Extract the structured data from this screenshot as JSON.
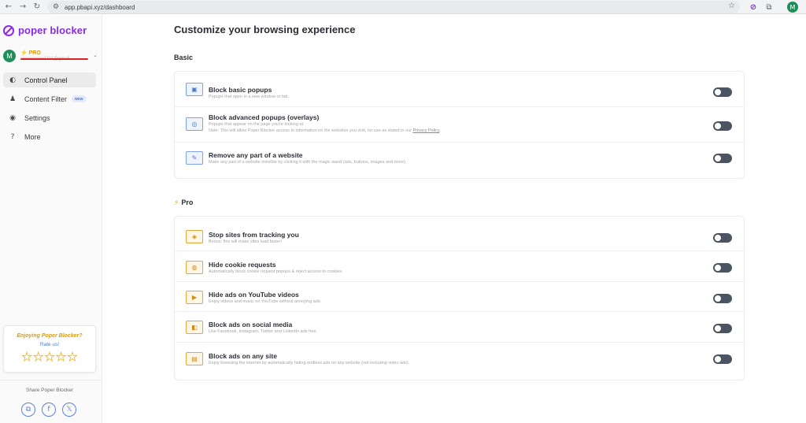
{
  "browser": {
    "back": "←",
    "forward": "→",
    "reload": "↻",
    "site_info": "⚙",
    "url": "app.pbapi.xyz/dashboard",
    "star": "☆",
    "ext_poper": "⊘",
    "ext_puzzle": "⧉",
    "profile_initial": "M"
  },
  "sidebar": {
    "logo_text": "poper blocker",
    "account": {
      "initial": "M",
      "plan": "⚡ PRO",
      "email": "xxxxxxxxxx1111@gmail",
      "chevron": "⌄"
    },
    "menu": [
      {
        "icon": "◐",
        "label": "Control Panel",
        "active": true
      },
      {
        "icon": "♟",
        "label": "Content Filter",
        "badge": "NEW"
      },
      {
        "icon": "◉",
        "label": "Settings"
      },
      {
        "icon": "?",
        "label": "More"
      }
    ],
    "rate_card": {
      "title": "Enjoying Poper Blocker?",
      "link": "Rate us!",
      "stars": [
        "★",
        "★",
        "★",
        "★",
        "★"
      ]
    },
    "share": {
      "label": "Share Poper Blocker",
      "icons": [
        "⧉",
        "f",
        "𝕏"
      ]
    }
  },
  "main": {
    "title": "Customize your browsing experience",
    "basic": {
      "heading": "Basic",
      "rows": [
        {
          "title": "Block basic popups",
          "desc": "Popups that open in a new window or tab.",
          "icon": "▣",
          "on": false
        },
        {
          "title": "Block advanced popups (overlays)",
          "desc": "Popups that appear on the page you're looking at.",
          "desc2_prefix": "Note: This will allow Poper Blocker access to information on the websites you visit, for use as stated in our ",
          "desc2_link": "Privacy Policy",
          "desc2_suffix": ".",
          "icon": "◎",
          "on": false
        },
        {
          "title": "Remove any part of a website",
          "desc": "Make any part of a website invisible by clicking it with the magic wand (ads, buttons, images and more).",
          "icon": "✎",
          "on": false
        }
      ]
    },
    "pro": {
      "bolt": "⚡",
      "heading": "Pro",
      "rows": [
        {
          "title": "Stop sites from tracking you",
          "desc": "Bonus: this will make sites load faster!",
          "icon": "◈",
          "on": false
        },
        {
          "title": "Hide cookie requests",
          "desc": "Automatically block cookie request popups & reject access to cookies.",
          "icon": "◍",
          "on": false
        },
        {
          "title": "Hide ads on YouTube videos",
          "desc": "Enjoy videos and music on YouTube without annoying ads.",
          "icon": "▶",
          "on": false
        },
        {
          "title": "Block ads on social media",
          "desc": "Use Facebook, Instagram, Twitter and LinkedIn ads free.",
          "icon": "◧",
          "on": false
        },
        {
          "title": "Block ads on any site",
          "desc": "Enjoy browsing the internet by automatically hiding endless ads on any website (not including video ads).",
          "icon": "▤",
          "on": false
        }
      ]
    }
  }
}
